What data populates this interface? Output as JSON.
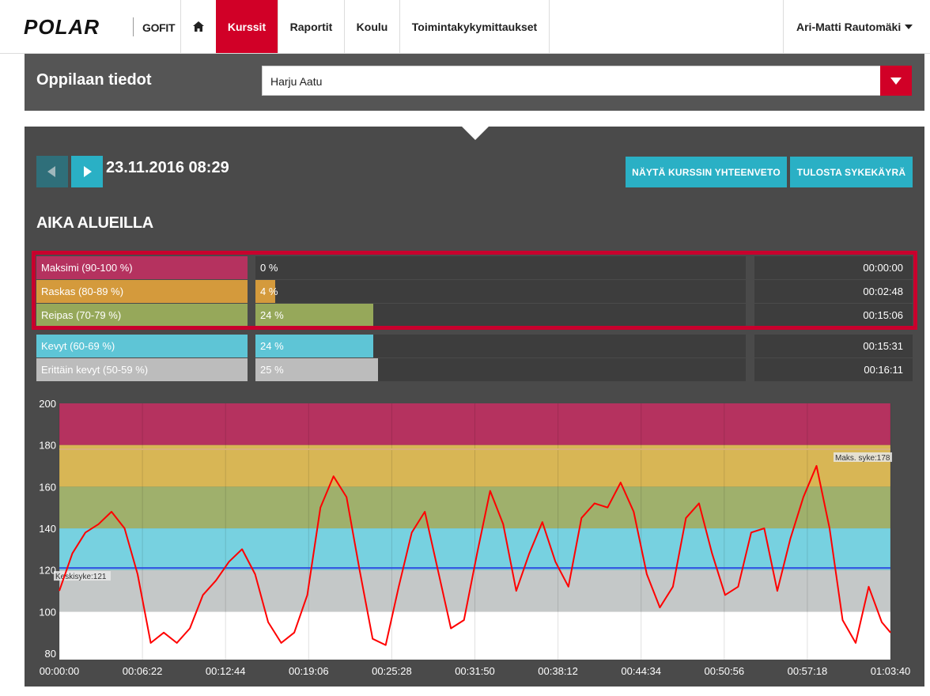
{
  "nav": {
    "brand": "POLAR",
    "product": "GOFIT",
    "items": [
      {
        "label": "Kurssit",
        "active": true
      },
      {
        "label": "Raportit",
        "active": false
      },
      {
        "label": "Koulu",
        "active": false
      },
      {
        "label": "Toimintakykymittaukset",
        "active": false
      }
    ],
    "user": "Ari-Matti Rautomäki"
  },
  "student": {
    "title": "Oppilaan tiedot",
    "selected": "Harju Aatu"
  },
  "session": {
    "datetime": "23.11.2016 08:29",
    "summary_button": "NÄYTÄ KURSSIN YHTEENVETO",
    "print_button": "TULOSTA SYKEKÄYRÄ"
  },
  "zones": {
    "title": "AIKA ALUEILLA",
    "rows": [
      {
        "label": "Maksimi (90-100 %)",
        "percent": "0 %",
        "value": 0,
        "time": "00:00:00",
        "color": "#b5325f"
      },
      {
        "label": "Raskas (80-89 %)",
        "percent": "4 %",
        "value": 4,
        "time": "00:02:48",
        "color": "#d49a3c"
      },
      {
        "label": "Reipas (70-79 %)",
        "percent": "24 %",
        "value": 24,
        "time": "00:15:06",
        "color": "#96a85a"
      },
      {
        "label": "Kevyt (60-69 %)",
        "percent": "24 %",
        "value": 24,
        "time": "00:15:31",
        "color": "#5ec5d6"
      },
      {
        "label": "Erittäin kevyt (50-59 %)",
        "percent": "25 %",
        "value": 25,
        "time": "00:16:11",
        "color": "#bcbcbc"
      }
    ]
  },
  "chart_data": {
    "type": "line",
    "title": "",
    "xlabel": "",
    "ylabel": "",
    "ylim": [
      77,
      200
    ],
    "xlim": [
      "00:00:00",
      "01:03:40"
    ],
    "y_ticks": [
      200,
      180,
      160,
      140,
      120,
      100,
      80
    ],
    "x_ticks": [
      "00:00:00",
      "00:06:22",
      "00:12:44",
      "00:19:06",
      "00:25:28",
      "00:31:50",
      "00:38:12",
      "00:44:34",
      "00:50:56",
      "00:57:18",
      "01:03:40"
    ],
    "grid": true,
    "zone_bands": [
      {
        "from": 180,
        "to": 200,
        "color": "#b5325f"
      },
      {
        "from": 160,
        "to": 180,
        "color": "#d8b655"
      },
      {
        "from": 140,
        "to": 160,
        "color": "#9fb06c"
      },
      {
        "from": 120,
        "to": 140,
        "color": "#77d1e0"
      },
      {
        "from": 100,
        "to": 120,
        "color": "#c4c8c8"
      },
      {
        "from": 77,
        "to": 100,
        "color": "#ffffff"
      }
    ],
    "lines": [
      {
        "label": "Maks. syke:178",
        "y": 178,
        "color": "#d8b07a"
      },
      {
        "label": "Keskisyke:121",
        "y": 121,
        "color": "#3050e0"
      }
    ],
    "series": [
      {
        "color": "#ff0000",
        "x_min": [
          0,
          1,
          2,
          3,
          4,
          5,
          6,
          7,
          8,
          9,
          10,
          11,
          12,
          13,
          14,
          15,
          16,
          17,
          18,
          19,
          20,
          21,
          22,
          23,
          24,
          25,
          26,
          27,
          28,
          29,
          30,
          31,
          32,
          33,
          34,
          35,
          36,
          37,
          38,
          39,
          40,
          41,
          42,
          43,
          44,
          45,
          46,
          47,
          48,
          49,
          50,
          51,
          52,
          53,
          54,
          55,
          56,
          57,
          58,
          59,
          60,
          61,
          62,
          63,
          63.67
        ],
        "values": [
          110,
          128,
          138,
          142,
          148,
          140,
          118,
          85,
          90,
          85,
          92,
          108,
          115,
          124,
          130,
          118,
          95,
          85,
          90,
          108,
          150,
          165,
          155,
          120,
          87,
          84,
          112,
          138,
          148,
          120,
          92,
          96,
          128,
          158,
          142,
          110,
          128,
          143,
          124,
          112,
          145,
          152,
          150,
          162,
          148,
          118,
          102,
          112,
          145,
          152,
          128,
          108,
          112,
          138,
          140,
          110,
          135,
          155,
          170,
          140,
          96,
          85,
          112,
          95,
          90
        ]
      }
    ]
  }
}
